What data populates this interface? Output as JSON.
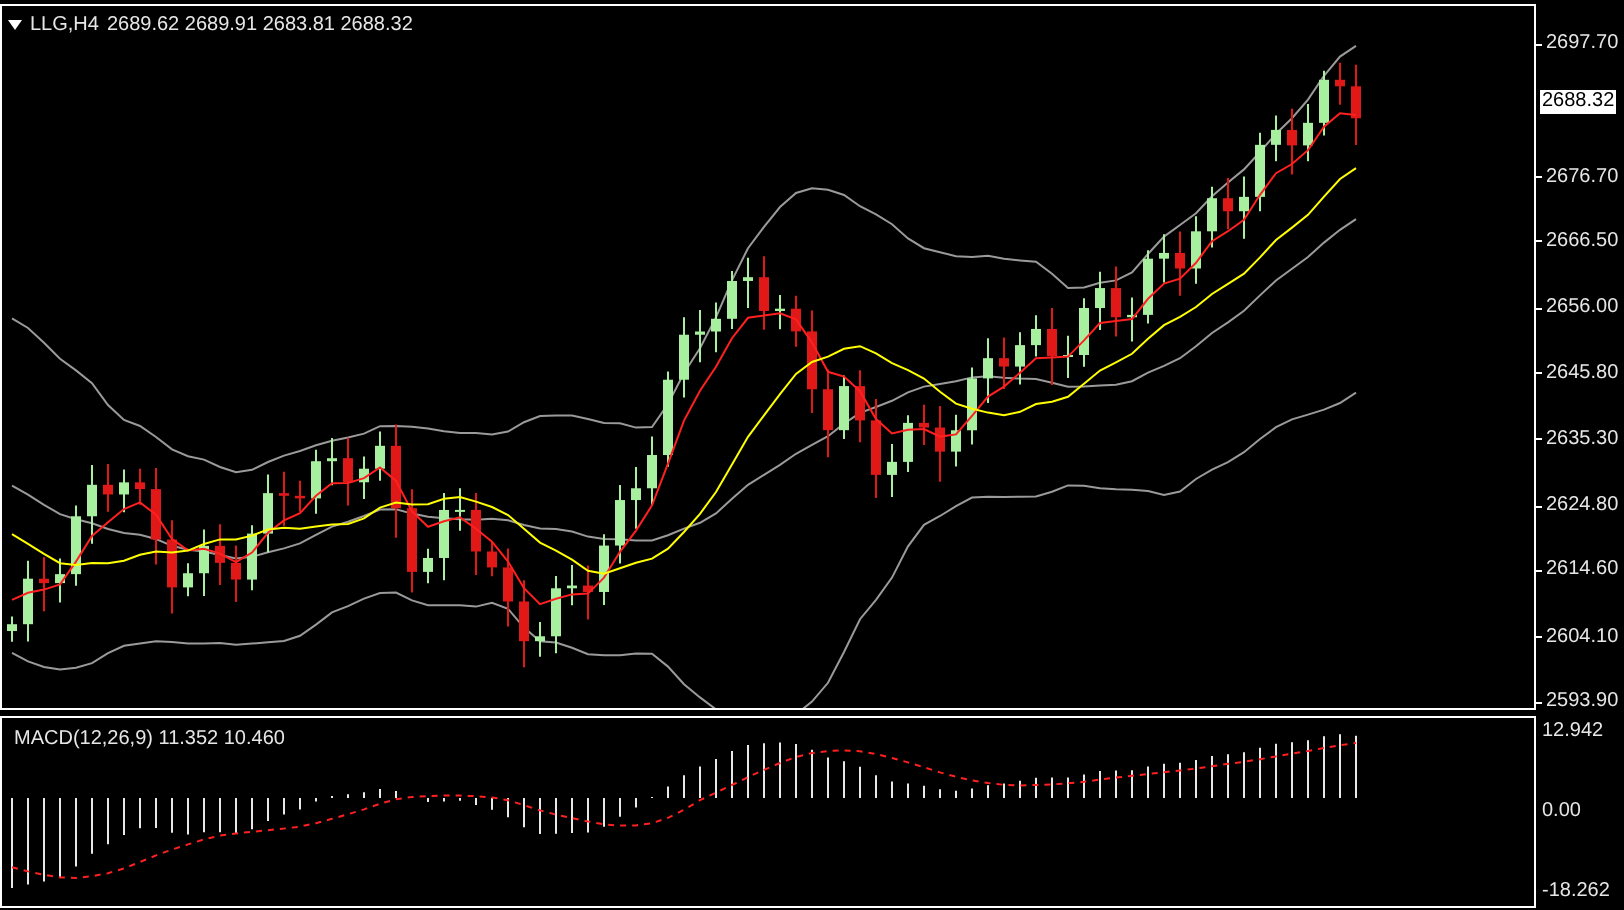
{
  "chart": {
    "symbol": "LLG,H4",
    "ohlc": "2689.62 2689.91 2683.81 2688.32"
  },
  "price_axis": {
    "ticks": [
      "2697.70",
      "2676.70",
      "2666.50",
      "2656.00",
      "2645.80",
      "2635.30",
      "2624.80",
      "2614.60",
      "2604.10",
      "2593.90"
    ],
    "current_price": "2688.32"
  },
  "macd": {
    "label": "MACD(12,26,9) 11.352 10.460",
    "ticks": [
      "12.942",
      "0.00",
      "-18.262"
    ]
  }
}
